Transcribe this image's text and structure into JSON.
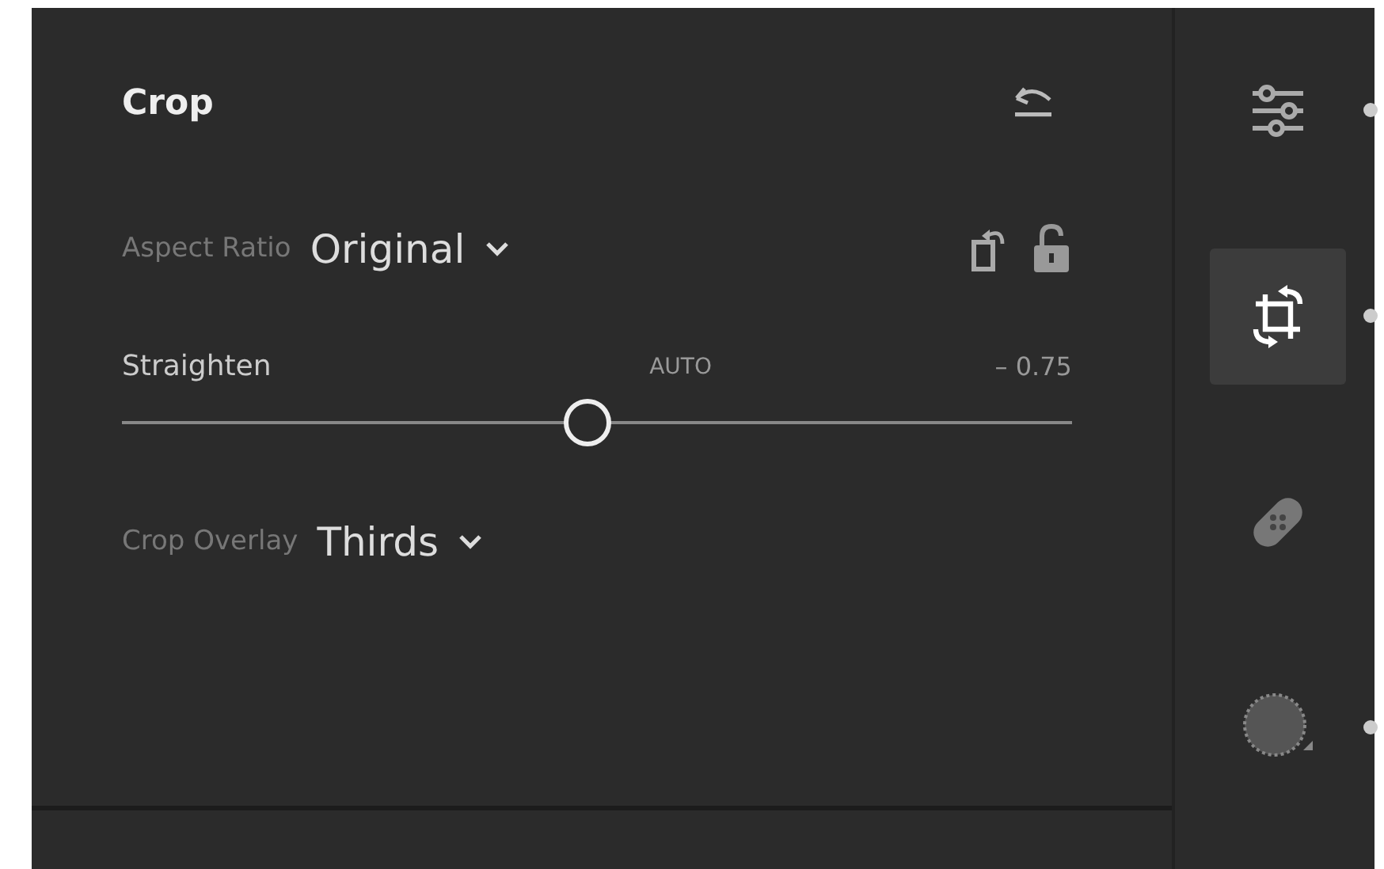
{
  "panel": {
    "title": "Crop"
  },
  "aspect_ratio": {
    "label": "Aspect Ratio",
    "value": "Original"
  },
  "straighten": {
    "label": "Straighten",
    "auto": "AUTO",
    "reading": "– 0.75",
    "level": 0.49
  },
  "crop_overlay": {
    "label": "Crop Overlay",
    "value": "Thirds"
  },
  "tools": [
    {
      "kind": "sliders",
      "selected": false,
      "dot": true
    },
    {
      "kind": "crop",
      "selected": true,
      "dot": true
    },
    {
      "kind": "bandage",
      "selected": false,
      "dot": false
    },
    {
      "kind": "mask",
      "selected": false,
      "dot": true
    }
  ]
}
